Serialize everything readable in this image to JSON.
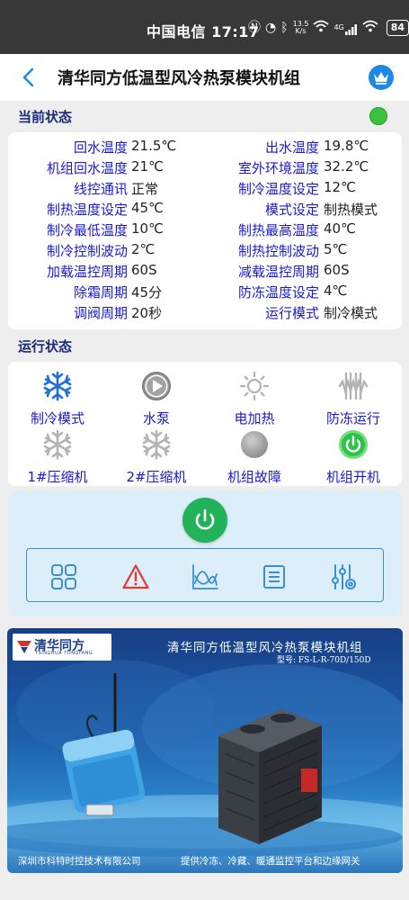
{
  "statusbar": {
    "carrier_time": "中国电信 17:17",
    "net_speed_value": "13.5",
    "net_speed_unit": "K/s",
    "signal_label": "4G",
    "battery": "84"
  },
  "header": {
    "title": "清华同方低温型风冷热泵模块机组"
  },
  "current_status": {
    "section_title": "当前状态",
    "rows": [
      {
        "label_left": "回水温度",
        "value_left": "21.5℃",
        "label_right": "出水温度",
        "value_right": "19.8℃"
      },
      {
        "label_left": "机组回水温度",
        "value_left": "21℃",
        "label_right": "室外环境温度",
        "value_right": "32.2℃"
      },
      {
        "label_left": "线控通讯",
        "value_left": "正常",
        "label_right": "制冷温度设定",
        "value_right": "12℃"
      },
      {
        "label_left": "制热温度设定",
        "value_left": "45℃",
        "label_right": "模式设定",
        "value_right": "制热模式"
      },
      {
        "label_left": "制冷最低温度",
        "value_left": "10℃",
        "label_right": "制热最高温度",
        "value_right": "40℃"
      },
      {
        "label_left": "制冷控制波动",
        "value_left": "2℃",
        "label_right": "制热控制波动",
        "value_right": "5℃"
      },
      {
        "label_left": "加载温控周期",
        "value_left": "60S",
        "label_right": "减载温控周期",
        "value_right": "60S"
      },
      {
        "label_left": "除霜周期",
        "value_left": "45分",
        "label_right": "防冻温度设定",
        "value_right": "4℃"
      },
      {
        "label_left": "调阀周期",
        "value_left": "20秒",
        "label_right": "运行模式",
        "value_right": "制冷模式"
      }
    ]
  },
  "run_status": {
    "section_title": "运行状态",
    "items": [
      {
        "label": "制冷模式",
        "icon": "snowflake-icon",
        "active": true
      },
      {
        "label": "水泵",
        "icon": "pump-icon",
        "active": false
      },
      {
        "label": "电加热",
        "icon": "sun-icon",
        "active": false
      },
      {
        "label": "防冻运行",
        "icon": "antifreeze-icon",
        "active": false
      },
      {
        "label": "1#压缩机",
        "icon": "snowflake-icon",
        "active": false
      },
      {
        "label": "2#压缩机",
        "icon": "snowflake-icon",
        "active": false
      },
      {
        "label": "机组故障",
        "icon": "fault-indicator-icon",
        "active": false
      },
      {
        "label": "机组开机",
        "icon": "power-icon",
        "active": true
      }
    ]
  },
  "colors": {
    "active_blue": "#1e6fd6",
    "inactive_gray": "#b3b3b3",
    "status_green": "#3cc23c",
    "power_green": "#22b35a",
    "label_blue": "#1a1acc",
    "alarm_red": "#e53935"
  },
  "control_bar": {
    "buttons": [
      "grid-icon",
      "alarm-icon",
      "curve-chart-icon",
      "list-icon",
      "settings-sliders-icon"
    ]
  },
  "banner": {
    "logo_cn": "清华同方",
    "logo_en": "TSINGHUA TONGFANG",
    "title": "清华同方低温型风冷热泵模块机组",
    "model": "型号: FS-L-R-70D/150D",
    "footer_left": "深圳市科特时控技术有限公司",
    "footer_right": "提供冷冻、冷藏、暖通监控平台和边缘网关"
  }
}
